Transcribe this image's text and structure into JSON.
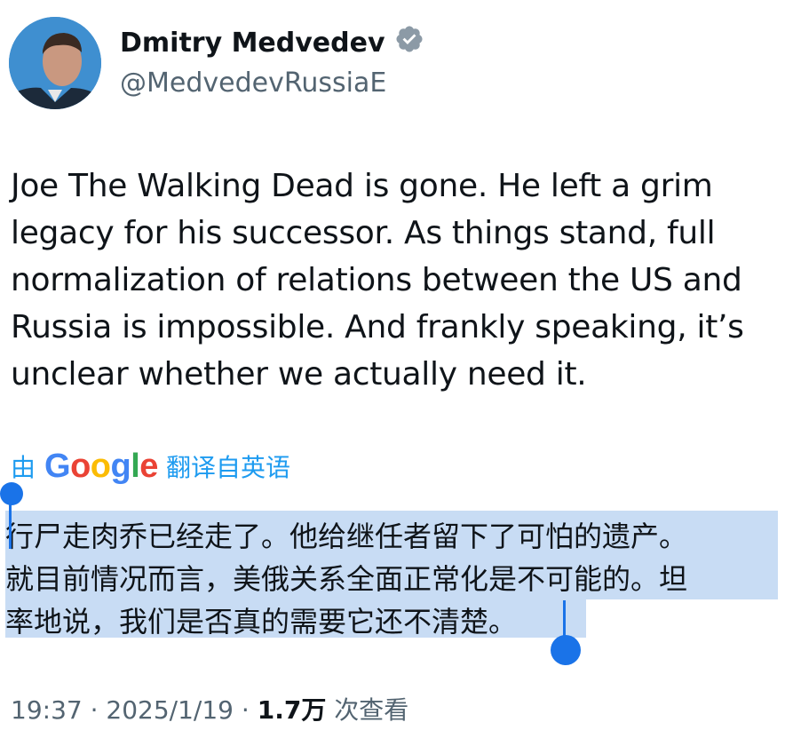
{
  "author": {
    "display_name": "Dmitry Medvedev",
    "handle": "@MedvedevRussiaE",
    "verified_icon": "verified-badge-icon"
  },
  "tweet": {
    "lines": [
      "Joe The Walking Dead is gone. He left a grim",
      "legacy for his successor. As things stand, full",
      "normalization of relations between the US and",
      "Russia is impossible. And frankly speaking, it’s",
      "unclear whether we actually need it."
    ]
  },
  "translation": {
    "prefix": "由",
    "provider": "Google",
    "suffix": "翻译自英语",
    "lines": [
      "行尸走肉乔已经走了。他给继任者留下了可怕的遗产。",
      "就目前情况而言，美俄关系全面正常化是不可能的。坦",
      "率地说，我们是否真的需要它还不清楚。"
    ]
  },
  "meta": {
    "time": "19:37",
    "sep1": "·",
    "date": "2025/1/19",
    "sep2": "·",
    "views_count": "1.7万",
    "views_label": "次查看"
  },
  "colors": {
    "link_blue": "#1d9bf0",
    "selection": "#c8dcf4",
    "handle_blue": "#1a73e8",
    "secondary_text": "#536471"
  }
}
